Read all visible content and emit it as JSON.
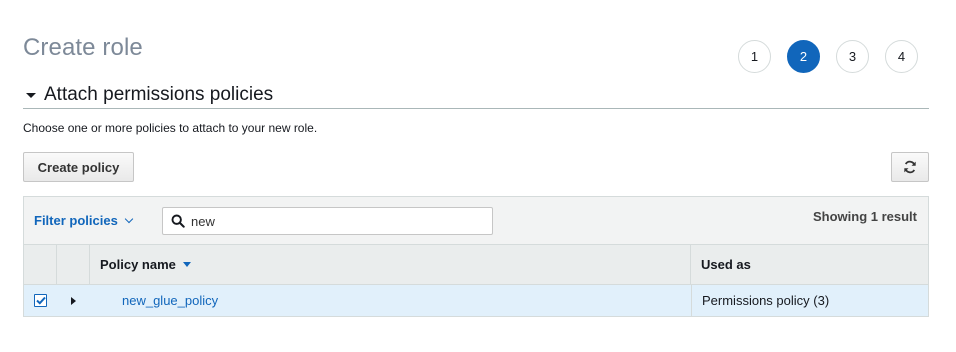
{
  "page": {
    "title": "Create role"
  },
  "steps": [
    {
      "label": "1",
      "active": false
    },
    {
      "label": "2",
      "active": true
    },
    {
      "label": "3",
      "active": false
    },
    {
      "label": "4",
      "active": false
    }
  ],
  "section": {
    "title": "Attach permissions policies",
    "description": "Choose one or more policies to attach to your new role."
  },
  "toolbar": {
    "create_policy_label": "Create policy",
    "refresh_icon": "refresh-icon"
  },
  "filter": {
    "label": "Filter policies",
    "search_value": "new",
    "result_count": "Showing 1 result"
  },
  "table": {
    "columns": {
      "name": "Policy name",
      "used_as": "Used as"
    },
    "rows": [
      {
        "name": "new_glue_policy",
        "used_as": "Permissions policy (3)",
        "checked": true
      }
    ]
  },
  "colors": {
    "accent": "#1166bb",
    "selected_row": "#e1f0fb",
    "title_gray": "#7d8998"
  }
}
